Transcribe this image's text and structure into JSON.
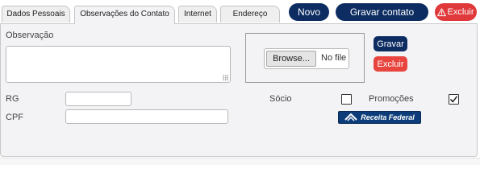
{
  "tabs": [
    {
      "label": "Dados Pessoais"
    },
    {
      "label": "Observações do Contato"
    },
    {
      "label": "Internet"
    },
    {
      "label": "Endereço"
    }
  ],
  "toolbar": {
    "novo_label": "Novo",
    "gravar_contato_label": "Gravar contato",
    "excluir_label": "Excluir"
  },
  "form": {
    "observacao_label": "Observação",
    "observacao_value": "",
    "file": {
      "browse_label": "Browse...",
      "status": "No file"
    },
    "gravar_label": "Gravar",
    "excluir_label": "Excluir",
    "rg_label": "RG",
    "rg_value": "",
    "cpf_label": "CPF",
    "cpf_value": "",
    "socio_label": "Sócio",
    "socio_checked": false,
    "promocoes_label": "Promoções",
    "promocoes_checked": true,
    "receita_label": "Receita Federal"
  },
  "colors": {
    "primary": "#0d2d62",
    "danger": "#e0393b",
    "receita": "#0c3d7a"
  }
}
